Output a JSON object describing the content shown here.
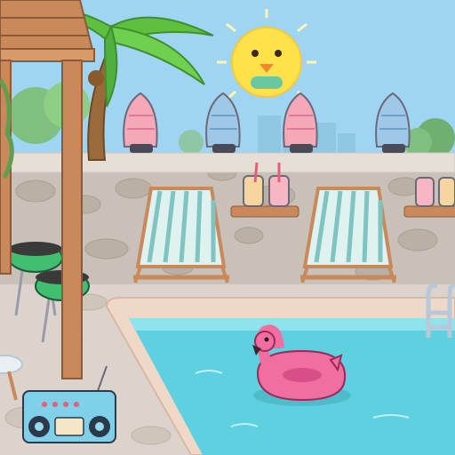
{
  "scene": {
    "colors": {
      "sky": "#9fd4f2",
      "sun": "#ffe24a",
      "wall": "#c9c1b8",
      "wall_cap": "#e6dfd6",
      "patio": "#dcd4cc",
      "pool_water": "#5fd0e0",
      "pool_edge": "#f0d8c8",
      "chair_stripe": "#7fc4c0",
      "grill": "#3fbf6f",
      "flamingo": "#f06fa0",
      "palm": "#5fbf3f",
      "pergola_wood": "#c9895a"
    },
    "items": [
      "palm-tree",
      "sun-character",
      "seashell-vase",
      "seashell-vase",
      "seashell-vase",
      "seashell-vase",
      "striped-deck-chair",
      "striped-deck-chair",
      "drink-jar",
      "drink-jar",
      "drink-jar",
      "drink-jar",
      "bbq-grill",
      "bbq-grill",
      "swimming-pool",
      "pool-ladder",
      "flamingo-float",
      "boombox",
      "wooden-pergola"
    ]
  }
}
